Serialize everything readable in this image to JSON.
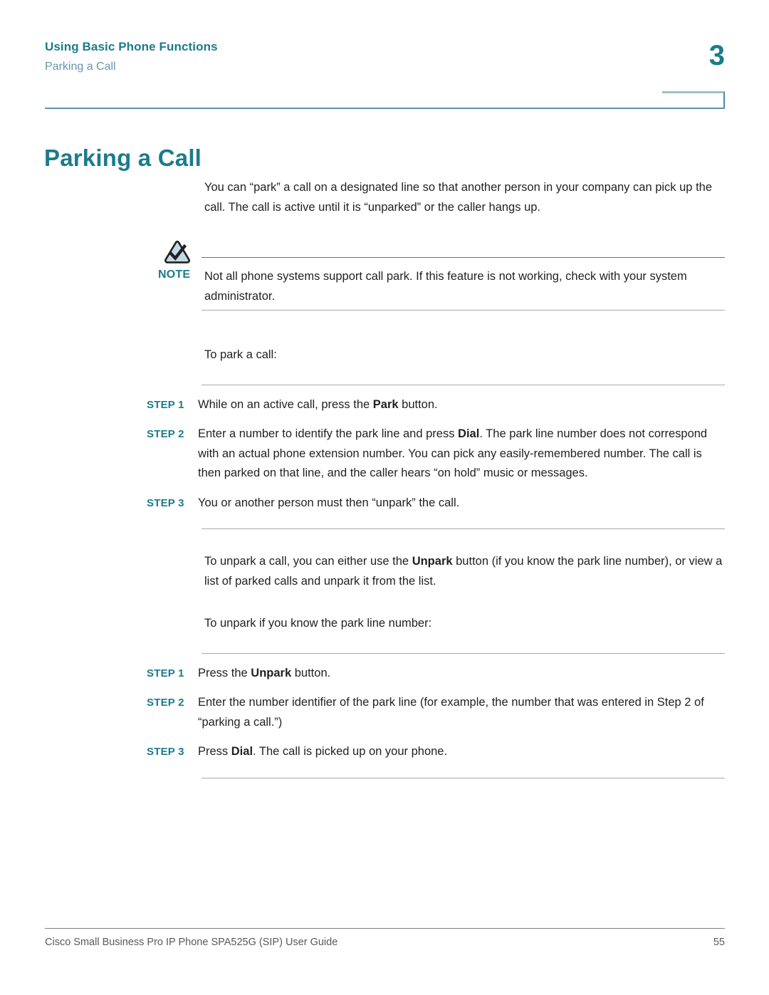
{
  "header": {
    "chapter_title": "Using Basic Phone Functions",
    "section_title": "Parking a Call",
    "chapter_number": "3"
  },
  "title": "Parking a Call",
  "intro_paragraph": "You can “park” a call on a designated line so that another person in your company can pick up the call. The call is active until it is “unparked” or the caller hangs up.",
  "note": {
    "label": "NOTE",
    "icon": "note-triangle-check-icon",
    "text": "Not all phone systems support call park. If this feature is not working, check with your system administrator."
  },
  "park_section": {
    "lead_in": "To park a call:",
    "steps": [
      {
        "label": "STEP 1",
        "text_before": "While on an active call, press the ",
        "bold": "Park",
        "text_after": " button."
      },
      {
        "label": "STEP 2",
        "text_before": "Enter a number to identify the park line and press ",
        "bold": "Dial",
        "text_after": ". The park line number does not correspond with an actual phone extension number. You can pick any easily-remembered number. The call is then parked on that line, and the caller hears “on hold” music or messages."
      },
      {
        "label": "STEP 3",
        "text_before": "You or another person must then “unpark” the call.",
        "bold": "",
        "text_after": ""
      }
    ]
  },
  "unpark_intro": {
    "text_before": "To unpark a call, you can either use the ",
    "bold": "Unpark",
    "text_after": " button (if you know the park line number), or view a list of parked calls and unpark it from the list."
  },
  "unpark_section": {
    "lead_in": "To unpark if you know the park line number:",
    "steps": [
      {
        "label": "STEP 1",
        "text_before": "Press the ",
        "bold": "Unpark",
        "text_after": " button."
      },
      {
        "label": "STEP 2",
        "text_before": "Enter the number identifier of the park line (for example, the number that was entered in Step 2 of “parking a call.”)",
        "bold": "",
        "text_after": ""
      },
      {
        "label": "STEP 3",
        "text_before": "Press ",
        "bold": "Dial",
        "text_after": ". The call is picked up on your phone."
      }
    ]
  },
  "footer": {
    "document_title": "Cisco Small Business Pro IP Phone SPA525G (SIP) User Guide",
    "page_number": "55"
  },
  "colors": {
    "teal": "#1b7b8c",
    "steel_blue": "#6694ac",
    "rule_blue": "#5e93b5",
    "rule_gray": "#a7a9ac",
    "body_text": "#231f20",
    "note_icon_fill": "#c3d9e6"
  }
}
